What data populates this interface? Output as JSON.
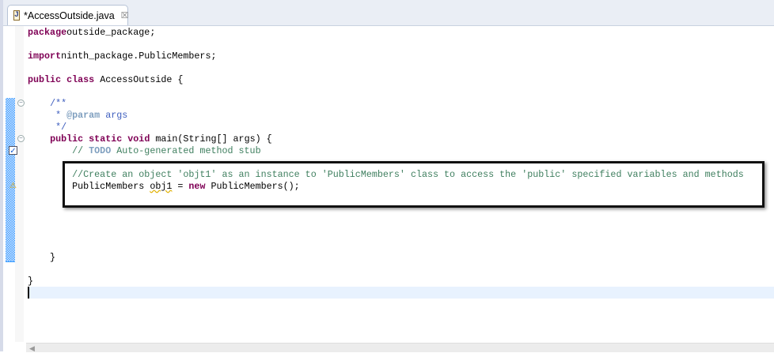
{
  "tab": {
    "icon": "java-file-icon",
    "icon_glyph": "J",
    "title": "*AccessOutside.java",
    "close_glyph": "☒"
  },
  "code": [
    [
      [
        "kw",
        "package"
      ],
      [
        "",
        "outside_package;"
      ]
    ],
    [],
    [
      [
        "kw",
        "import"
      ],
      [
        "",
        "ninth_package.PublicMembers;"
      ]
    ],
    [],
    [
      [
        "kw",
        "public"
      ],
      [
        "",
        " "
      ],
      [
        "kw",
        "class"
      ],
      [
        "",
        " AccessOutside {"
      ]
    ],
    [],
    [
      [
        "",
        "    "
      ],
      [
        "jd",
        "/**"
      ]
    ],
    [
      [
        "",
        "     "
      ],
      [
        "jd",
        "* "
      ],
      [
        "jt",
        "@param"
      ],
      [
        "jd",
        " args"
      ]
    ],
    [
      [
        "",
        "     "
      ],
      [
        "jd",
        "*/"
      ]
    ],
    [
      [
        "",
        "    "
      ],
      [
        "kw",
        "public"
      ],
      [
        "",
        " "
      ],
      [
        "kw",
        "static"
      ],
      [
        "",
        " "
      ],
      [
        "kw",
        "void"
      ],
      [
        "",
        " main(String[] args) {"
      ]
    ],
    [
      [
        "",
        "        "
      ],
      [
        "cm",
        "// "
      ],
      [
        "todo",
        "TODO"
      ],
      [
        "cm",
        " Auto-generated method stub"
      ]
    ],
    [],
    [
      [
        "",
        "        "
      ],
      [
        "cm",
        "//Create an object 'objt1' as an instance to 'PublicMembers' class to access the 'public' specified variables and methods"
      ]
    ],
    [
      [
        "",
        "        PublicMembers "
      ],
      [
        "warn",
        "obj1"
      ],
      [
        "",
        " = "
      ],
      [
        "kw",
        "new"
      ],
      [
        "",
        " PublicMembers();"
      ]
    ],
    [],
    [],
    [],
    [],
    [],
    [
      [
        "",
        "    }"
      ]
    ],
    [],
    [
      [
        "",
        "}"
      ]
    ]
  ],
  "ruler_color": "#4da3ff",
  "annotations": {
    "task_icon": "task-checkbox-icon",
    "warning_icon": "lightbulb-warning-icon"
  }
}
